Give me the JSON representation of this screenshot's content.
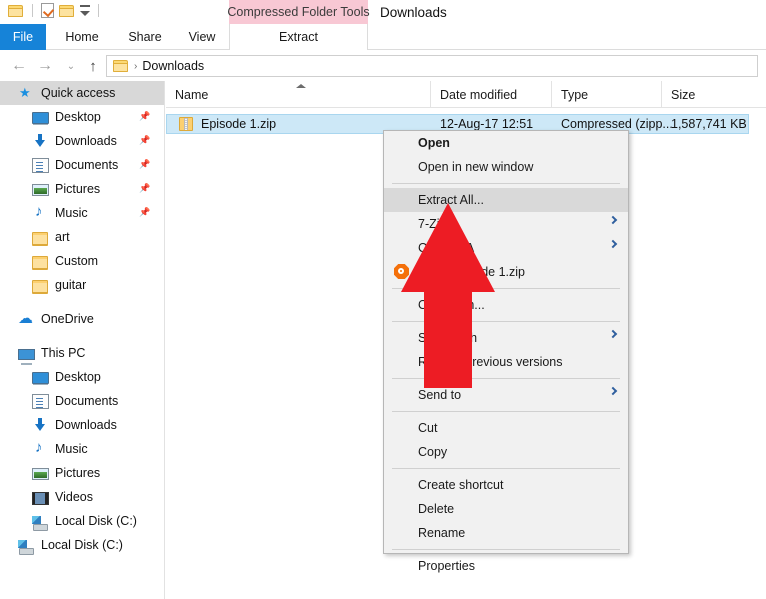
{
  "window": {
    "title": "Downloads",
    "contextual_tab_group": "Compressed Folder Tools",
    "contextual_tab_color": "#f8c8d4",
    "accent_color": "#1683d8"
  },
  "quick_access_toolbar": {
    "items": [
      {
        "name": "folder-icon",
        "label": ""
      },
      {
        "name": "properties-icon",
        "label": ""
      },
      {
        "name": "new-folder-icon",
        "label": ""
      },
      {
        "name": "customize-caret-icon",
        "label": ""
      }
    ]
  },
  "ribbon": {
    "tabs": [
      {
        "label": "File",
        "selected": true
      },
      {
        "label": "Home",
        "selected": false
      },
      {
        "label": "Share",
        "selected": false
      },
      {
        "label": "View",
        "selected": false
      },
      {
        "label": "Extract",
        "selected": false
      }
    ]
  },
  "addressbar": {
    "back_icon": "←",
    "forward_icon": "→",
    "recent_icon": "⌄",
    "up_icon": "↑",
    "separator": "›",
    "path": "Downloads"
  },
  "sidebar": {
    "items": [
      {
        "label": "Quick access",
        "icon": "star-icon",
        "indent": 0,
        "selected": true,
        "pinned": false
      },
      {
        "label": "Desktop",
        "icon": "desktop-icon",
        "indent": 1,
        "selected": false,
        "pinned": true
      },
      {
        "label": "Downloads",
        "icon": "download-icon",
        "indent": 1,
        "selected": false,
        "pinned": true
      },
      {
        "label": "Documents",
        "icon": "document-icon",
        "indent": 1,
        "selected": false,
        "pinned": true
      },
      {
        "label": "Pictures",
        "icon": "pictures-icon",
        "indent": 1,
        "selected": false,
        "pinned": true
      },
      {
        "label": "Music",
        "icon": "music-icon",
        "indent": 1,
        "selected": false,
        "pinned": true
      },
      {
        "label": "art",
        "icon": "folder-icon",
        "indent": 1,
        "selected": false,
        "pinned": false
      },
      {
        "label": "Custom",
        "icon": "folder-icon",
        "indent": 1,
        "selected": false,
        "pinned": false
      },
      {
        "label": "guitar",
        "icon": "folder-icon",
        "indent": 1,
        "selected": false,
        "pinned": false
      },
      {
        "label": "",
        "icon": "spacer",
        "indent": 0,
        "selected": false,
        "pinned": false
      },
      {
        "label": "OneDrive",
        "icon": "onedrive-icon",
        "indent": 0,
        "selected": false,
        "pinned": false
      },
      {
        "label": "",
        "icon": "spacer",
        "indent": 0,
        "selected": false,
        "pinned": false
      },
      {
        "label": "This PC",
        "icon": "thispc-icon",
        "indent": 0,
        "selected": false,
        "pinned": false
      },
      {
        "label": "Desktop",
        "icon": "desktop-icon",
        "indent": 1,
        "selected": false,
        "pinned": false
      },
      {
        "label": "Documents",
        "icon": "document-icon",
        "indent": 1,
        "selected": false,
        "pinned": false
      },
      {
        "label": "Downloads",
        "icon": "download-icon",
        "indent": 1,
        "selected": false,
        "pinned": false
      },
      {
        "label": "Music",
        "icon": "music-icon",
        "indent": 1,
        "selected": false,
        "pinned": false
      },
      {
        "label": "Pictures",
        "icon": "pictures-icon",
        "indent": 1,
        "selected": false,
        "pinned": false
      },
      {
        "label": "Videos",
        "icon": "videos-icon",
        "indent": 1,
        "selected": false,
        "pinned": false
      },
      {
        "label": "Local Disk (C:)",
        "icon": "disk-icon",
        "indent": 1,
        "selected": false,
        "pinned": false
      },
      {
        "label": "Local Disk (C:)",
        "icon": "disk-icon",
        "indent": 0,
        "selected": false,
        "pinned": false
      }
    ]
  },
  "filelist": {
    "columns": [
      "Name",
      "Date modified",
      "Type",
      "Size"
    ],
    "sorted_column": "Name",
    "sort_direction": "ascending",
    "rows": [
      {
        "name": "Episode 1.zip",
        "date_modified": "12-Aug-17 12:51",
        "type": "Compressed (zipp...",
        "size": "1,587,741 KB",
        "icon": "zip-file-icon",
        "selected": true
      }
    ]
  },
  "context_menu": {
    "items": [
      {
        "label": "Open",
        "type": "item",
        "bold": true,
        "highlighted": false,
        "submenu": false,
        "icon": ""
      },
      {
        "label": "Open in new window",
        "type": "item",
        "bold": false,
        "highlighted": false,
        "submenu": false,
        "icon": ""
      },
      {
        "label": "",
        "type": "separator",
        "bold": false,
        "highlighted": false,
        "submenu": false,
        "icon": ""
      },
      {
        "label": "Extract All...",
        "type": "item",
        "bold": false,
        "highlighted": true,
        "submenu": false,
        "icon": ""
      },
      {
        "label": "7-Zip",
        "type": "item",
        "bold": false,
        "highlighted": false,
        "submenu": true,
        "icon": ""
      },
      {
        "label": "CRC SHA",
        "type": "item",
        "bold": false,
        "highlighted": false,
        "submenu": true,
        "icon": ""
      },
      {
        "label": "Scan Episode 1.zip",
        "type": "item",
        "bold": false,
        "highlighted": false,
        "submenu": false,
        "icon": "avast-icon"
      },
      {
        "label": "",
        "type": "separator",
        "bold": false,
        "highlighted": false,
        "submenu": false,
        "icon": ""
      },
      {
        "label": "Open with...",
        "type": "item",
        "bold": false,
        "highlighted": false,
        "submenu": false,
        "icon": ""
      },
      {
        "label": "",
        "type": "separator",
        "bold": false,
        "highlighted": false,
        "submenu": false,
        "icon": ""
      },
      {
        "label": "Share with",
        "type": "item",
        "bold": false,
        "highlighted": false,
        "submenu": true,
        "icon": ""
      },
      {
        "label": "Restore previous versions",
        "type": "item",
        "bold": false,
        "highlighted": false,
        "submenu": false,
        "icon": ""
      },
      {
        "label": "",
        "type": "separator",
        "bold": false,
        "highlighted": false,
        "submenu": false,
        "icon": ""
      },
      {
        "label": "Send to",
        "type": "item",
        "bold": false,
        "highlighted": false,
        "submenu": true,
        "icon": ""
      },
      {
        "label": "",
        "type": "separator",
        "bold": false,
        "highlighted": false,
        "submenu": false,
        "icon": ""
      },
      {
        "label": "Cut",
        "type": "item",
        "bold": false,
        "highlighted": false,
        "submenu": false,
        "icon": ""
      },
      {
        "label": "Copy",
        "type": "item",
        "bold": false,
        "highlighted": false,
        "submenu": false,
        "icon": ""
      },
      {
        "label": "",
        "type": "separator",
        "bold": false,
        "highlighted": false,
        "submenu": false,
        "icon": ""
      },
      {
        "label": "Create shortcut",
        "type": "item",
        "bold": false,
        "highlighted": false,
        "submenu": false,
        "icon": ""
      },
      {
        "label": "Delete",
        "type": "item",
        "bold": false,
        "highlighted": false,
        "submenu": false,
        "icon": ""
      },
      {
        "label": "Rename",
        "type": "item",
        "bold": false,
        "highlighted": false,
        "submenu": false,
        "icon": ""
      },
      {
        "label": "",
        "type": "separator",
        "bold": false,
        "highlighted": false,
        "submenu": false,
        "icon": ""
      },
      {
        "label": "Properties",
        "type": "item",
        "bold": false,
        "highlighted": false,
        "submenu": false,
        "icon": ""
      }
    ]
  },
  "annotation": {
    "arrow_color": "#ed1c24",
    "arrow_direction": "up",
    "points_at": "Extract All..."
  }
}
